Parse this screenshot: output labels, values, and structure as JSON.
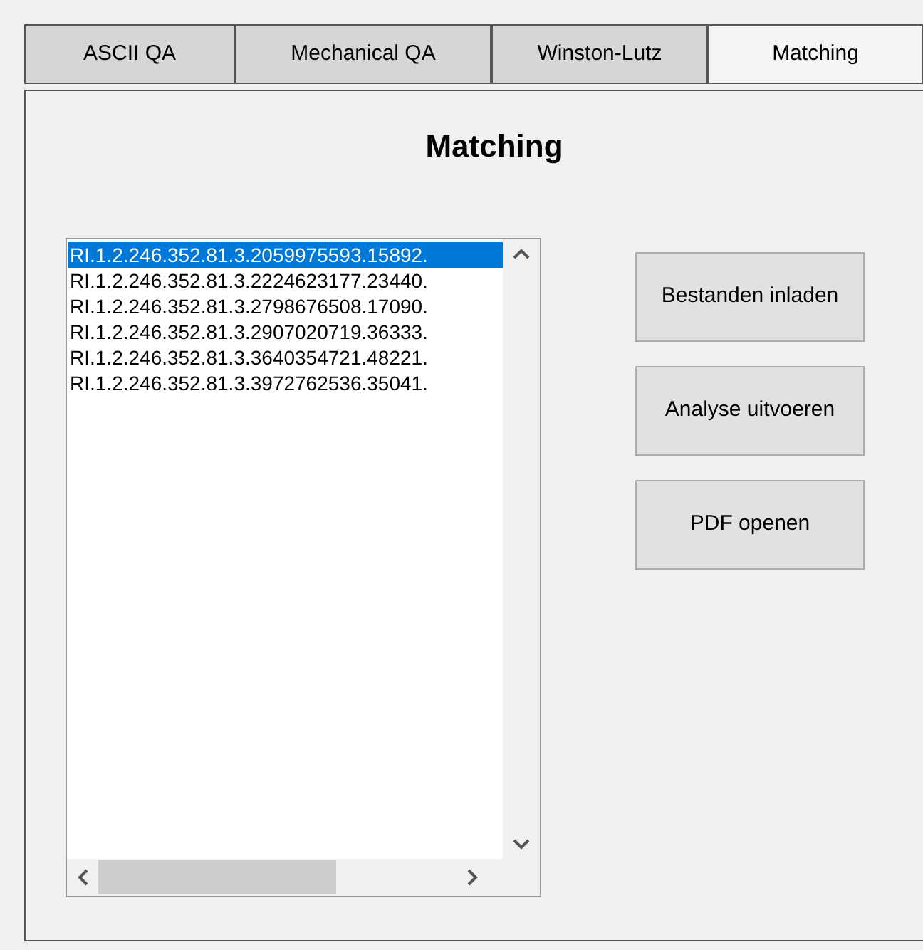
{
  "tabs": [
    {
      "label": "ASCII QA",
      "selected": false
    },
    {
      "label": "Mechanical QA",
      "selected": false
    },
    {
      "label": "Winston-Lutz",
      "selected": false
    },
    {
      "label": "Matching",
      "selected": true
    }
  ],
  "panel": {
    "title": "Matching",
    "files": [
      {
        "label": "RI.1.2.246.352.81.3.2059975593.15892.",
        "selected": true
      },
      {
        "label": "RI.1.2.246.352.81.3.2224623177.23440.",
        "selected": false
      },
      {
        "label": "RI.1.2.246.352.81.3.2798676508.17090.",
        "selected": false
      },
      {
        "label": "RI.1.2.246.352.81.3.2907020719.36333.",
        "selected": false
      },
      {
        "label": "RI.1.2.246.352.81.3.3640354721.48221.",
        "selected": false
      },
      {
        "label": "RI.1.2.246.352.81.3.3972762536.35041.",
        "selected": false
      }
    ],
    "buttons": [
      "Bestanden inladen",
      "Analyse uitvoeren",
      "PDF openen"
    ]
  }
}
